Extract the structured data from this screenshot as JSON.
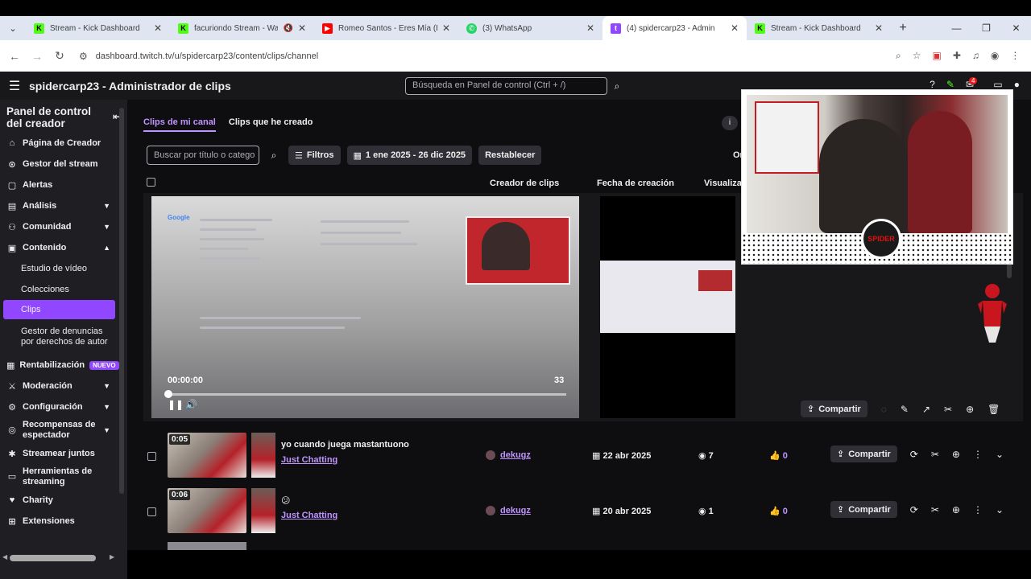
{
  "browser": {
    "tabs": [
      {
        "title": "Stream - Kick Dashboard",
        "favicon": "kick-logo",
        "color": "#53fc18"
      },
      {
        "title": "facuriondo Stream - Wa",
        "favicon": "kick-logo",
        "color": "#53fc18",
        "muted": true
      },
      {
        "title": "Romeo Santos - Eres Mía (Le",
        "favicon": "youtube-logo",
        "color": "#ff0000"
      },
      {
        "title": "(3) WhatsApp",
        "favicon": "whatsapp-logo",
        "color": "#25d366"
      },
      {
        "title": "(4) spidercarp23 - Admin",
        "favicon": "twitch-logo",
        "color": "#9147ff",
        "active": true
      },
      {
        "title": "Stream - Kick Dashboard",
        "favicon": "kick-logo",
        "color": "#53fc18"
      }
    ],
    "url": "dashboard.twitch.tv/u/spidercarp23/content/clips/channel"
  },
  "topbar": {
    "title": "spidercarp23 - Administrador de clips",
    "search_placeholder": "Búsqueda en Panel de control (Ctrl + /)",
    "notifications": "4"
  },
  "sidebar": {
    "header": "Panel de control del creador",
    "items": [
      {
        "label": "Página de Creador",
        "icon": "home-icon"
      },
      {
        "label": "Gestor del stream",
        "icon": "stream-manager-icon"
      },
      {
        "label": "Alertas",
        "icon": "alert-icon"
      },
      {
        "label": "Análisis",
        "icon": "analytics-icon",
        "chevron": "down"
      },
      {
        "label": "Comunidad",
        "icon": "community-icon",
        "chevron": "down"
      },
      {
        "label": "Contenido",
        "icon": "content-icon",
        "chevron": "up"
      }
    ],
    "content_sub": [
      "Estudio de vídeo",
      "Colecciones",
      "Clips",
      "Gestor de denuncias por derechos de autor"
    ],
    "items2": [
      {
        "label": "Rentabilización",
        "badge": "NUEVO"
      },
      {
        "label": "Moderación",
        "chevron": "down"
      },
      {
        "label": "Configuración",
        "chevron": "down"
      },
      {
        "label": "Recompensas de espectador",
        "chevron": "down"
      },
      {
        "label": "Streamear juntos"
      },
      {
        "label": "Herramientas de streaming"
      },
      {
        "label": "Charity"
      },
      {
        "label": "Extensiones"
      }
    ]
  },
  "main": {
    "tabs": [
      "Clips de mi canal",
      "Clips que he creado"
    ],
    "filters": {
      "search_placeholder": "Buscar por título o catego",
      "filters_label": "Filtros",
      "date_range": "1 ene 2025 - 26 dic 2025",
      "reset_label": "Restablecer",
      "order_label": "Or"
    },
    "columns": [
      "Creador de clips",
      "Fecha de creación",
      "Visualiza"
    ],
    "player": {
      "current_time": "00:00:00",
      "duration": "33",
      "progress": 0
    },
    "share_label": "Compartir",
    "rows": [
      {
        "duration": "0:05",
        "title": "yo cuando juega mastantuono",
        "category": "Just Chatting",
        "creator": "dekugz",
        "date": "22 abr 2025",
        "views": "7",
        "likes": "0"
      },
      {
        "duration": "0:06",
        "title": "😕",
        "category": "Just Chatting",
        "creator": "dekugz",
        "date": "20 abr 2025",
        "views": "1",
        "likes": "0"
      }
    ]
  }
}
